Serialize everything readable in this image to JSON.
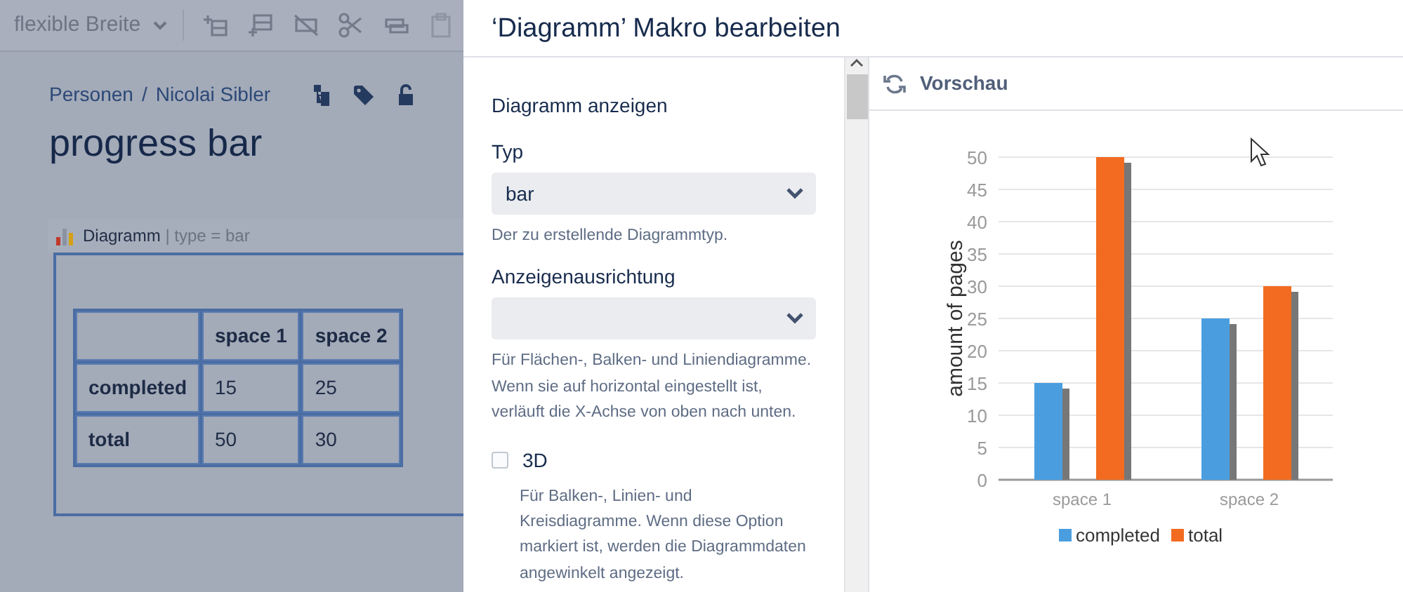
{
  "page": {
    "toolbar": {
      "width_select": "flexible Breite"
    },
    "breadcrumb": [
      "Personen",
      "Nicolai Sibler"
    ],
    "breadcrumb_separator": "/",
    "title": "progress bar",
    "macro": {
      "name": "Diagramm",
      "params": "| type = bar",
      "table": {
        "columns": [
          "space 1",
          "space 2"
        ],
        "rows": [
          {
            "label": "completed",
            "cells": [
              "15",
              "25"
            ]
          },
          {
            "label": "total",
            "cells": [
              "50",
              "30"
            ]
          }
        ]
      }
    }
  },
  "dialog": {
    "title": "‘Diagramm’ Makro bearbeiten",
    "form": {
      "section": "Diagramm anzeigen",
      "fields": [
        {
          "kind": "select",
          "label": "Typ",
          "value": "bar",
          "help": "Der zu erstellende Diagrammtyp."
        },
        {
          "kind": "select",
          "label": "Anzeigenausrichtung",
          "help": "Für Flächen-, Balken- und Liniendiagramme. Wenn sie auf horizontal eingestellt ist, verläuft die X-Achse von oben nach unten."
        },
        {
          "kind": "checkbox",
          "label": "3D",
          "checked": false,
          "help": "Für Balken-, Linien- und Kreisdiagramme. Wenn diese Option markiert ist, werden die Diagrammdaten angewinkelt angezeigt."
        }
      ]
    },
    "preview": {
      "title": "Vorschau",
      "chart_data": {
        "type": "bar",
        "grid": true,
        "legend": true,
        "ylabel": "amount of pages",
        "categories": [
          "space 1",
          "space 2"
        ],
        "series": [
          {
            "name": "completed",
            "color": "#4a9ee0",
            "values": [
              15,
              25
            ]
          },
          {
            "name": "total",
            "color": "#f26b21",
            "values": [
              50,
              30
            ]
          }
        ],
        "ylim": [
          0,
          50
        ],
        "yticks": [
          0,
          5,
          10,
          15,
          20,
          25,
          30,
          35,
          40,
          45,
          50
        ]
      }
    }
  }
}
